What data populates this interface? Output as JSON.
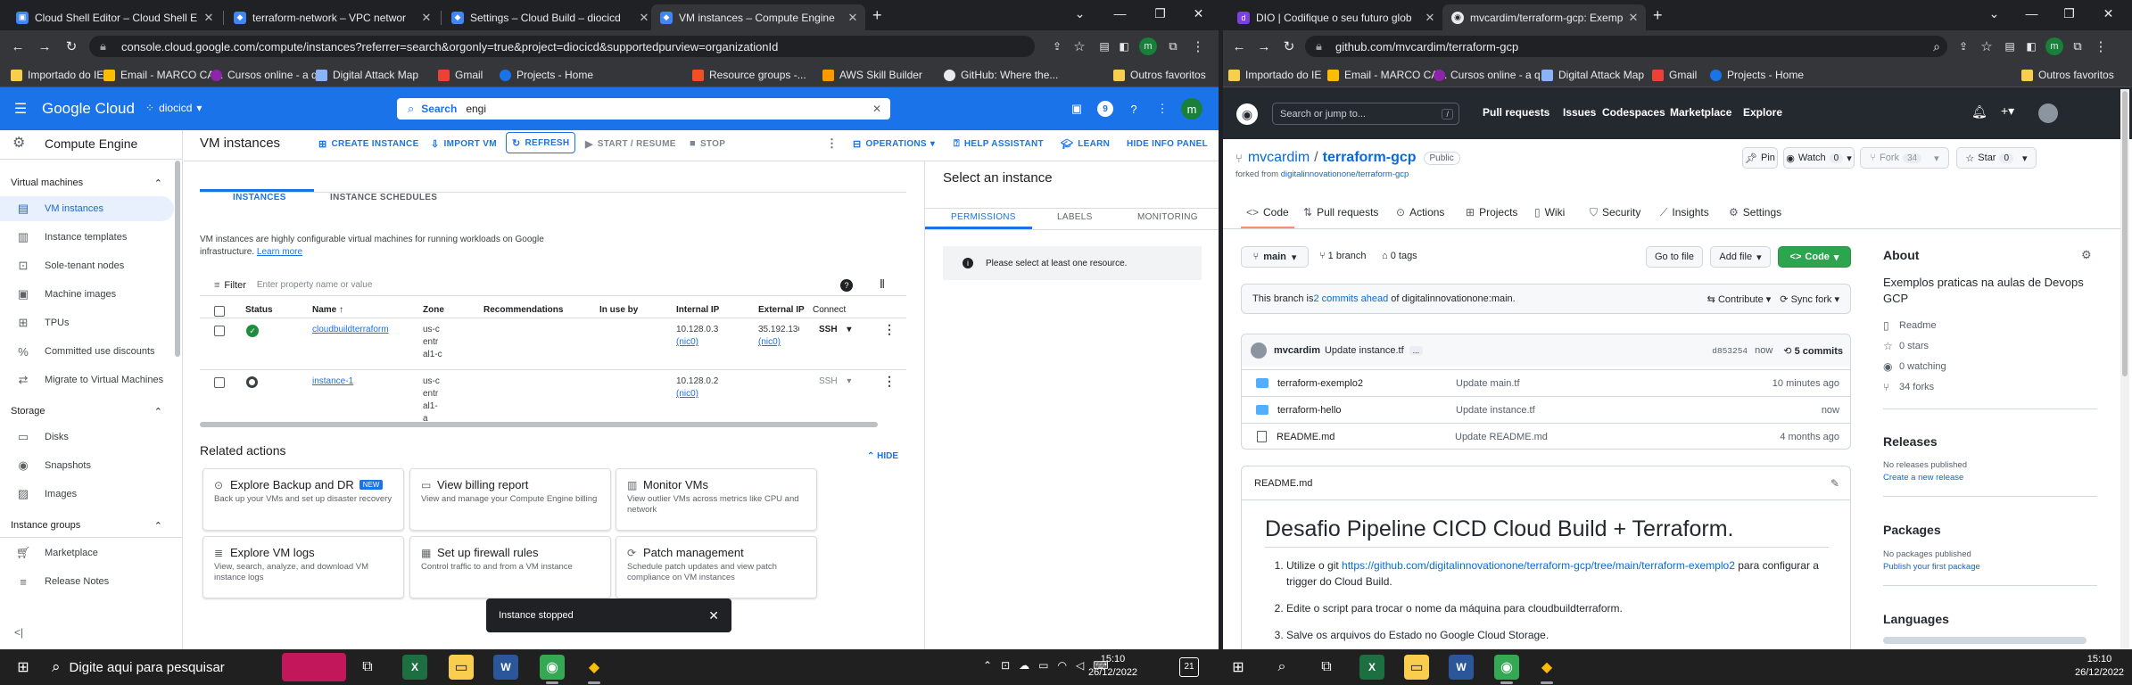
{
  "left_browser": {
    "tabs": [
      {
        "title": "Cloud Shell Editor – Cloud Shell E",
        "favicon": "cloud-shell-icon",
        "active": false
      },
      {
        "title": "terraform-network – VPC networ",
        "favicon": "gcp-icon",
        "active": false
      },
      {
        "title": "Settings – Cloud Build – diocicd",
        "favicon": "gcp-icon",
        "active": false
      },
      {
        "title": "VM instances – Compute Engine",
        "favicon": "gcp-icon",
        "active": true
      }
    ],
    "new_tab": "+",
    "url": "console.cloud.google.com/compute/instances?referrer=search&orgonly=true&project=diocicd&supportedpurview=organizationId",
    "bookmarks": [
      "Importado do IE",
      "Email - MARCO CA...",
      "Cursos online - a q...",
      "Digital Attack Map",
      "Gmail",
      "Projects - Home",
      "Resource groups -...",
      "AWS Skill Builder",
      "GitHub: Where the...",
      "Outros favoritos"
    ],
    "avatar": "m"
  },
  "gcp": {
    "brand": "Google Cloud",
    "project": "diocicd",
    "search": {
      "label": "Search",
      "value": "engi"
    },
    "product": "Compute Engine",
    "sidebar": {
      "sections": [
        {
          "title": "Virtual machines",
          "items": [
            {
              "label": "VM instances",
              "icon": "vm-icon",
              "selected": true
            },
            {
              "label": "Instance templates",
              "icon": "template-icon"
            },
            {
              "label": "Sole-tenant nodes",
              "icon": "node-icon"
            },
            {
              "label": "Machine images",
              "icon": "image-icon"
            },
            {
              "label": "TPUs",
              "icon": "tpu-icon"
            },
            {
              "label": "Committed use discounts",
              "icon": "percent-icon"
            },
            {
              "label": "Migrate to Virtual Machines",
              "icon": "migrate-icon"
            }
          ]
        },
        {
          "title": "Storage",
          "items": [
            {
              "label": "Disks",
              "icon": "disk-icon"
            },
            {
              "label": "Snapshots",
              "icon": "snapshot-icon"
            },
            {
              "label": "Images",
              "icon": "images-icon"
            }
          ]
        },
        {
          "title": "Instance groups",
          "items": []
        }
      ],
      "footer": [
        {
          "label": "Marketplace",
          "icon": "cart-icon"
        },
        {
          "label": "Release Notes",
          "icon": "notes-icon"
        }
      ],
      "collapse": "<|"
    },
    "toolbar": {
      "title": "VM instances",
      "create": "CREATE INSTANCE",
      "import": "IMPORT VM",
      "refresh": "REFRESH",
      "start": "START / RESUME",
      "stop": "STOP",
      "operations": "OPERATIONS",
      "help": "HELP ASSISTANT",
      "learn": "LEARN",
      "hide_info": "HIDE INFO PANEL"
    },
    "tabs": [
      "INSTANCES",
      "INSTANCE SCHEDULES"
    ],
    "description": "VM instances are highly configurable virtual machines for running workloads on Google infrastructure.",
    "learn_more": "Learn more",
    "filter": {
      "label": "Filter",
      "placeholder": "Enter property name or value"
    },
    "table": {
      "columns": [
        "Status",
        "Name",
        "Zone",
        "Recommendations",
        "In use by",
        "Internal IP",
        "External IP",
        "Connect"
      ],
      "rows": [
        {
          "status": "running",
          "name": "cloudbuildterraform",
          "zone": "us-central1-c",
          "internal_ip": "10.128.0.3",
          "internal_nic": "(nic0)",
          "external_ip": "35.192.136",
          "external_nic": "(nic0)",
          "connect": "SSH"
        },
        {
          "status": "stopped",
          "name": "instance-1",
          "zone": "us-central1-a",
          "internal_ip": "10.128.0.2",
          "internal_nic": "(nic0)",
          "external_ip": "",
          "external_nic": "",
          "connect": "SSH"
        }
      ]
    },
    "related": {
      "title": "Related actions",
      "hide": "HIDE",
      "cards": [
        {
          "title": "Explore Backup and DR",
          "badge": "NEW",
          "icon": "backup-icon",
          "desc": "Back up your VMs and set up disaster recovery"
        },
        {
          "title": "View billing report",
          "icon": "billing-icon",
          "desc": "View and manage your Compute Engine billing"
        },
        {
          "title": "Monitor VMs",
          "icon": "monitor-icon",
          "desc": "View outlier VMs across metrics like CPU and network"
        },
        {
          "title": "Explore VM logs",
          "icon": "logs-icon",
          "desc": "View, search, analyze, and download VM instance logs"
        },
        {
          "title": "Set up firewall rules",
          "icon": "firewall-icon",
          "desc": "Control traffic to and from a VM instance"
        },
        {
          "title": "Patch management",
          "icon": "patch-icon",
          "desc": "Schedule patch updates and view patch compliance on VM instances"
        }
      ]
    },
    "info_panel": {
      "title": "Select an instance",
      "tabs": [
        "PERMISSIONS",
        "LABELS",
        "MONITORING"
      ],
      "message": "Please select at least one resource."
    },
    "toast": "Instance stopped",
    "colors": {
      "primary": "#1a73e8",
      "running": "#1e8e3e"
    }
  },
  "right_browser": {
    "tabs": [
      {
        "title": "DIO | Codifique o seu futuro glob",
        "favicon": "dio-icon",
        "active": false
      },
      {
        "title": "mvcardim/terraform-gcp: Exemp",
        "favicon": "github-icon",
        "active": true
      }
    ],
    "new_tab": "+",
    "url": "github.com/mvcardim/terraform-gcp",
    "bookmarks": [
      "Importado do IE",
      "Email - MARCO CA...",
      "Cursos online - a q...",
      "Digital Attack Map",
      "Gmail",
      "Projects - Home",
      "Outros favoritos"
    ],
    "avatar": "m"
  },
  "github": {
    "search_placeholder": "Search or jump to...",
    "search_key": "/",
    "nav": [
      "Pull requests",
      "Issues",
      "Codespaces",
      "Marketplace",
      "Explore"
    ],
    "owner": "mvcardim",
    "separator": "/",
    "repo": "terraform-gcp",
    "visibility": "Public",
    "forked_prefix": "forked from",
    "forked_from": "digitalinnovationone/terraform-gcp",
    "actions": {
      "pin": "Pin",
      "watch": "Watch",
      "watch_count": "0",
      "fork": "Fork",
      "fork_count": "34",
      "star": "Star",
      "star_count": "0"
    },
    "tabs": [
      "Code",
      "Pull requests",
      "Actions",
      "Projects",
      "Wiki",
      "Security",
      "Insights",
      "Settings"
    ],
    "branch": "main",
    "branches": "1 branch",
    "tags": "0 tags",
    "go_to_file": "Go to file",
    "add_file": "Add file",
    "code_btn": "Code",
    "ahead": {
      "prefix": "This branch is ",
      "link": "2 commits ahead",
      "suffix": " of digitalinnovationone:main."
    },
    "contribute": "Contribute",
    "sync": "Sync fork",
    "commit": {
      "author": "mvcardim",
      "message": "Update instance.tf",
      "ellipsis": "...",
      "hash": "d853254",
      "when": "now",
      "count": "5 commits"
    },
    "files": [
      {
        "name": "terraform-exemplo2",
        "type": "dir",
        "msg": "Update main.tf",
        "age": "10 minutes ago"
      },
      {
        "name": "terraform-hello",
        "type": "dir",
        "msg": "Update instance.tf",
        "age": "now"
      },
      {
        "name": "README.md",
        "type": "file",
        "msg": "Update README.md",
        "age": "4 months ago"
      }
    ],
    "readme": {
      "file": "README.md",
      "title": "Desafio Pipeline CICD Cloud Build + Terraform.",
      "items": [
        {
          "pre": "Utilize o git ",
          "link": "https://github.com/digitalinnovationone/terraform-gcp/tree/main/terraform-exemplo2",
          "post": " para configurar a trigger do Cloud Build."
        },
        {
          "pre": "Edite o script para trocar o nome da máquina para cloudbuildterraform.",
          "link": "",
          "post": ""
        },
        {
          "pre": "Salve os arquivos do Estado no Google Cloud Storage.",
          "link": "",
          "post": ""
        }
      ]
    },
    "about": {
      "title": "About",
      "desc": "Exemplos praticas na aulas de Devops GCP",
      "items": [
        {
          "icon": "book-icon",
          "label": "Readme"
        },
        {
          "icon": "star-icon",
          "label": "0 stars"
        },
        {
          "icon": "eye-icon",
          "label": "0 watching"
        },
        {
          "icon": "fork-icon",
          "label": "34 forks"
        }
      ]
    },
    "releases": {
      "title": "Releases",
      "none": "No releases published",
      "link": "Create a new release"
    },
    "packages": {
      "title": "Packages",
      "none": "No packages published",
      "link": "Publish your first package"
    },
    "languages": {
      "title": "Languages"
    }
  },
  "taskbar": {
    "search_placeholder": "Digite aqui para pesquisar",
    "clock_left": {
      "time": "15:10",
      "date": "26/12/2022"
    },
    "clock_right": {
      "time": "15:10",
      "date": "26/12/2022"
    },
    "notification_count": "21"
  }
}
